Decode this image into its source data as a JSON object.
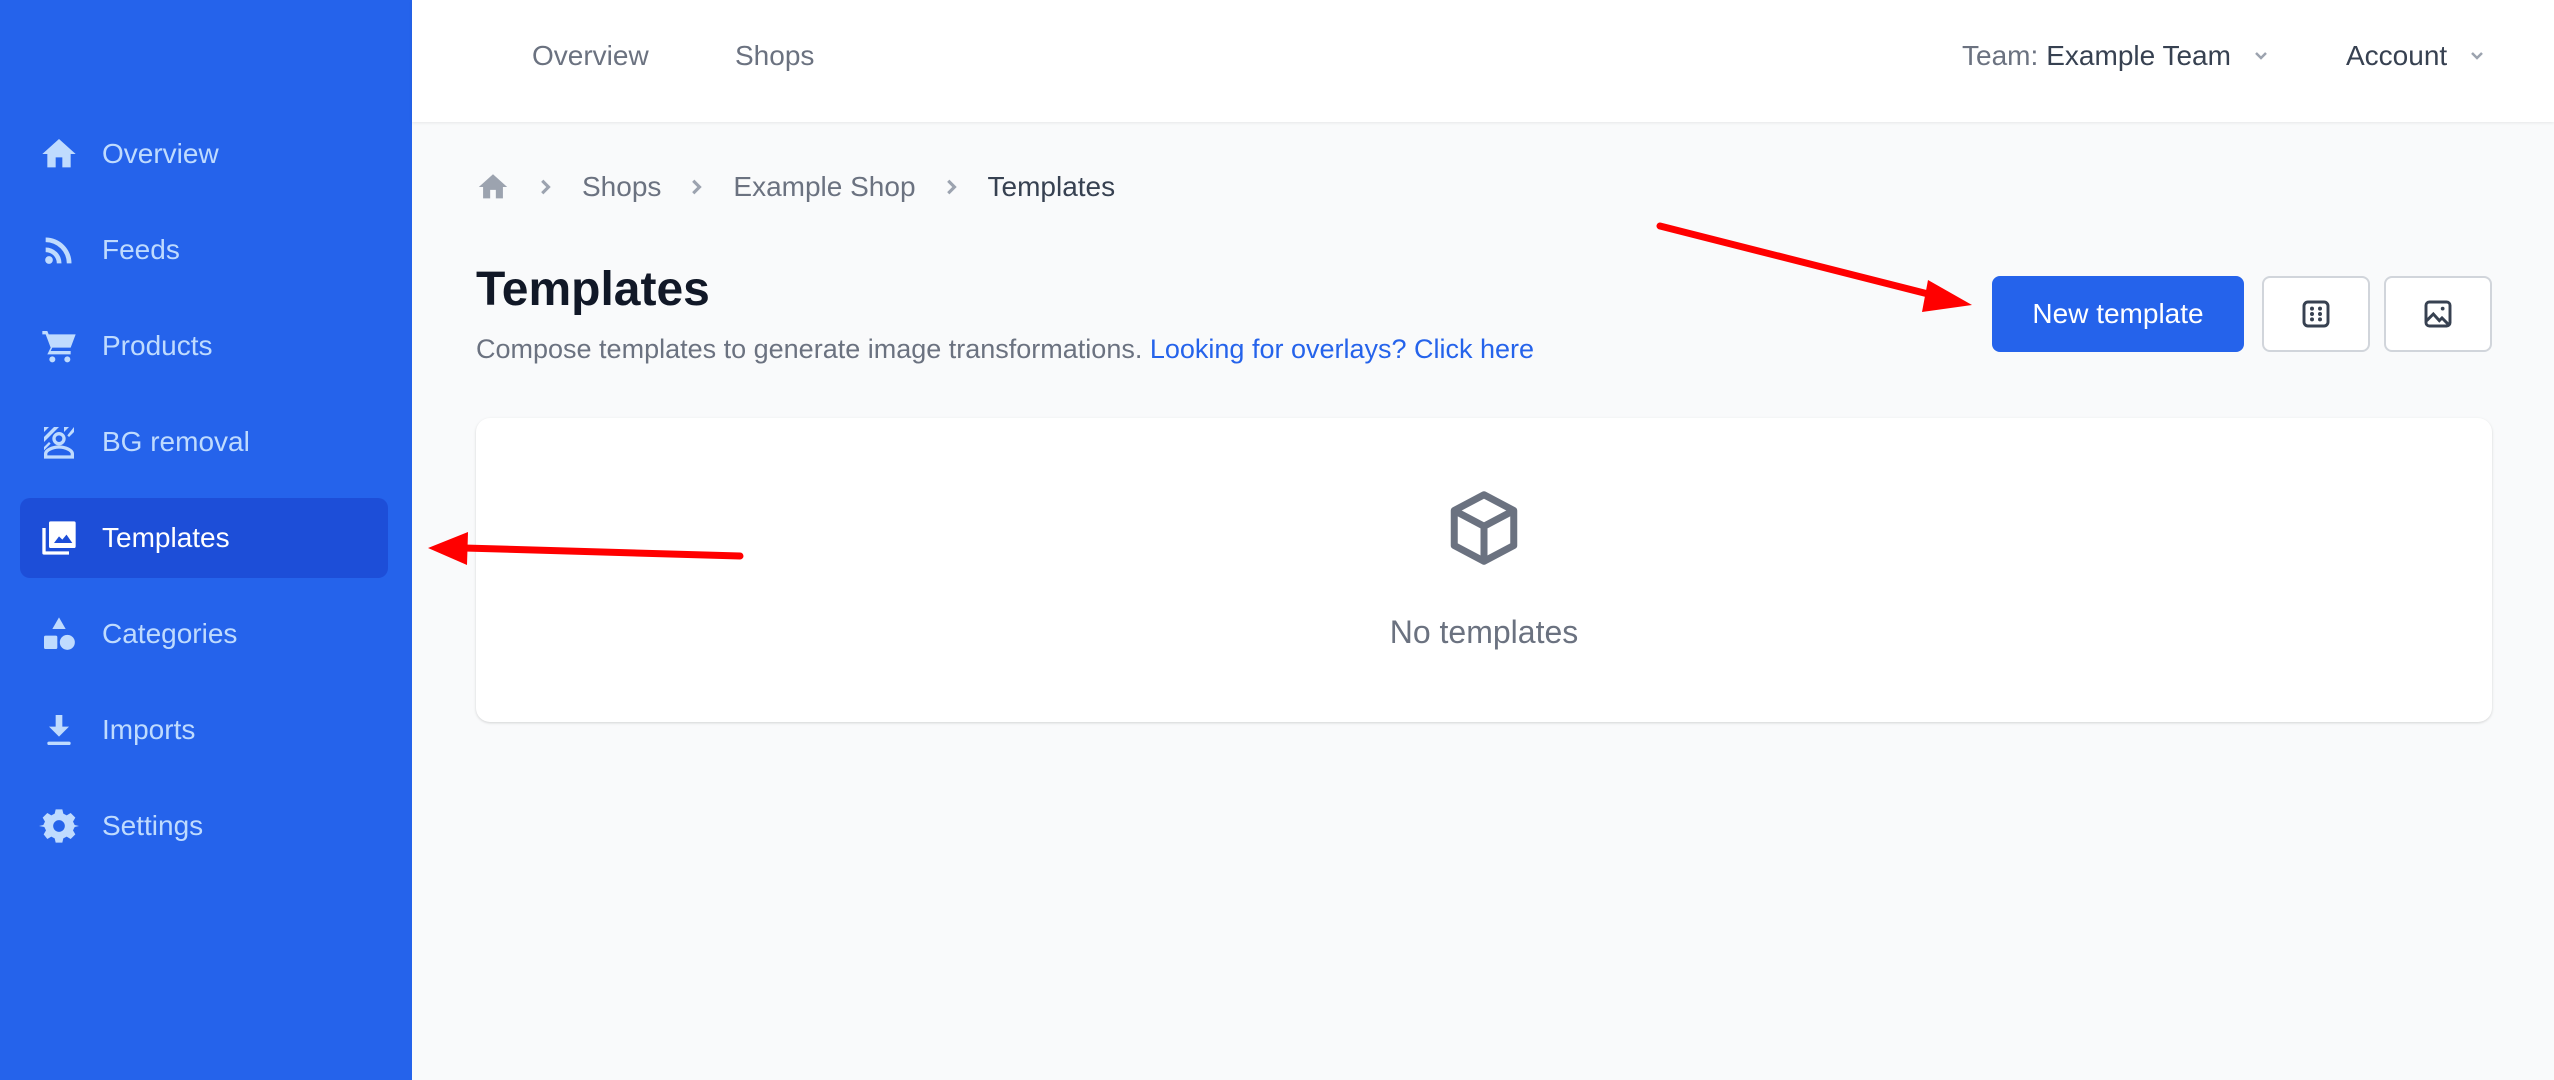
{
  "sidebar": {
    "items": [
      {
        "label": "Overview",
        "icon": "home-icon",
        "active": false
      },
      {
        "label": "Feeds",
        "icon": "rss-icon",
        "active": false
      },
      {
        "label": "Products",
        "icon": "shopping-cart-icon",
        "active": false
      },
      {
        "label": "BG removal",
        "icon": "bg-removal-icon",
        "active": false
      },
      {
        "label": "Templates",
        "icon": "images-icon",
        "active": true
      },
      {
        "label": "Categories",
        "icon": "shapes-icon",
        "active": false
      },
      {
        "label": "Imports",
        "icon": "download-icon",
        "active": false
      },
      {
        "label": "Settings",
        "icon": "gear-icon",
        "active": false
      }
    ]
  },
  "header": {
    "links": [
      "Overview",
      "Shops"
    ],
    "team_prefix": "Team:",
    "team_name": "Example Team",
    "account": "Account"
  },
  "breadcrumb": {
    "items": [
      "Shops",
      "Example Shop",
      "Templates"
    ]
  },
  "page": {
    "title": "Templates",
    "subtitle": "Compose templates to generate image transformations.",
    "link": "Looking for overlays? Click here",
    "new_button": "New template",
    "empty_text": "No templates"
  },
  "colors": {
    "brand": "#2563eb",
    "active_nav": "#1d4ed8",
    "annotation": "#ff0000"
  }
}
